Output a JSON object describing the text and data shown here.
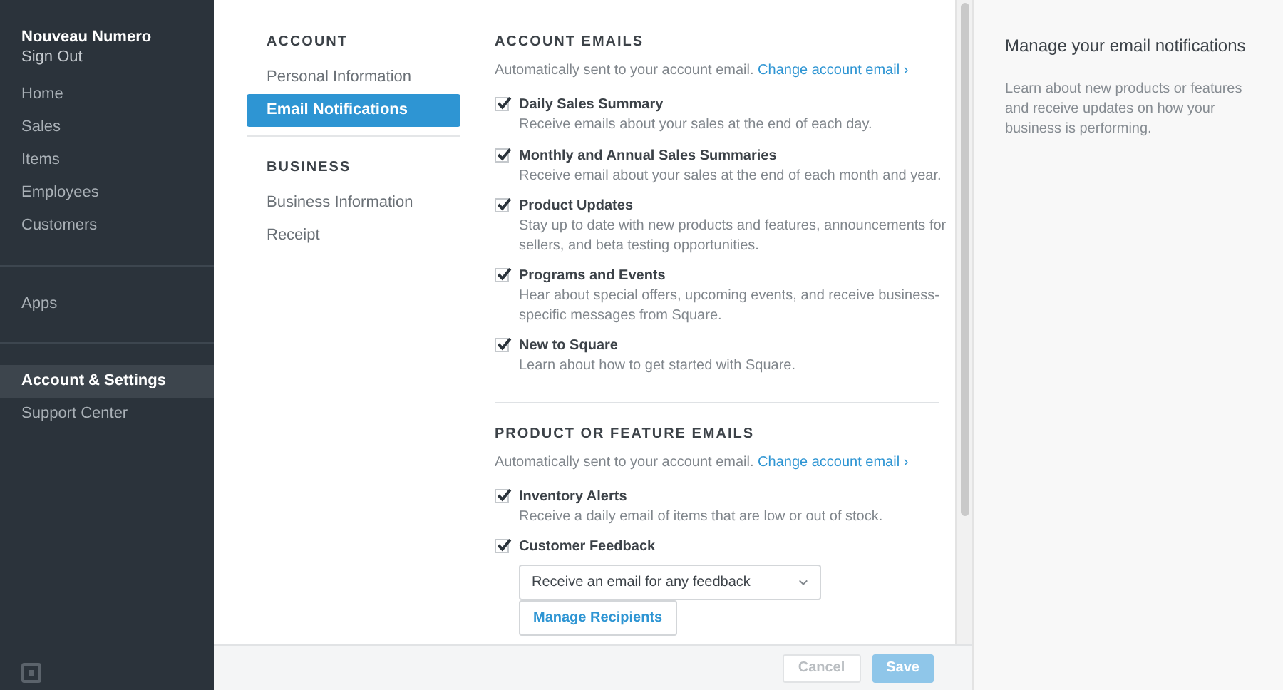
{
  "sidebar": {
    "user_name": "Nouveau Numero",
    "sign_out": "Sign Out",
    "groups": [
      [
        {
          "label": "Home",
          "selected": false
        },
        {
          "label": "Sales",
          "selected": false
        },
        {
          "label": "Items",
          "selected": false
        },
        {
          "label": "Employees",
          "selected": false
        },
        {
          "label": "Customers",
          "selected": false
        }
      ],
      [
        {
          "label": "Apps",
          "selected": false
        }
      ],
      [
        {
          "label": "Account & Settings",
          "selected": true
        },
        {
          "label": "Support Center",
          "selected": false
        }
      ]
    ]
  },
  "settings_nav": {
    "sections": [
      {
        "heading": "ACCOUNT",
        "items": [
          {
            "label": "Personal Information",
            "selected": false
          },
          {
            "label": "Email Notifications",
            "selected": true
          }
        ]
      },
      {
        "heading": "BUSINESS",
        "items": [
          {
            "label": "Business Information",
            "selected": false
          },
          {
            "label": "Receipt",
            "selected": false
          }
        ]
      }
    ]
  },
  "sections": [
    {
      "heading": "ACCOUNT EMAILS",
      "note": "Automatically sent to your account email.",
      "link": "Change account email ›",
      "options": [
        {
          "kind": "checkbox",
          "title": "Daily Sales Summary",
          "description": "Receive emails about your sales at the end of each day.",
          "checked": true
        },
        {
          "kind": "checkbox",
          "title": "Monthly and Annual Sales Summaries",
          "description": "Receive email about your sales at the end of each month and year.",
          "checked": true
        },
        {
          "kind": "checkbox",
          "title": "Product Updates",
          "description": "Stay up to date with new products and features, announcements for sellers, and beta testing opportunities.",
          "checked": true
        },
        {
          "kind": "checkbox",
          "title": "Programs and Events",
          "description": "Hear about special offers, upcoming events, and receive business-specific messages from Square.",
          "checked": true
        },
        {
          "kind": "checkbox",
          "title": "New to Square",
          "description": "Learn about how to get started with Square.",
          "checked": true
        }
      ]
    },
    {
      "heading": "PRODUCT OR FEATURE EMAILS",
      "note": "Automatically sent to your account email.",
      "link": "Change account email ›",
      "options": [
        {
          "kind": "checkbox",
          "title": "Inventory Alerts",
          "description": "Receive a daily email of items that are low or out of stock.",
          "checked": true
        },
        {
          "kind": "checkbox_select",
          "title": "Customer Feedback",
          "checked": true,
          "select_value": "Receive an email for any feedback",
          "button": "Manage Recipients"
        }
      ]
    }
  ],
  "footer": {
    "buttons": [
      {
        "label": "Cancel",
        "kind": "secondary",
        "disabled": true
      },
      {
        "label": "Save",
        "kind": "primary",
        "disabled": true
      }
    ]
  },
  "help_panel": {
    "title": "Manage your email notifications",
    "body": "Learn about new products or features and receive updates on how your business is performing."
  }
}
